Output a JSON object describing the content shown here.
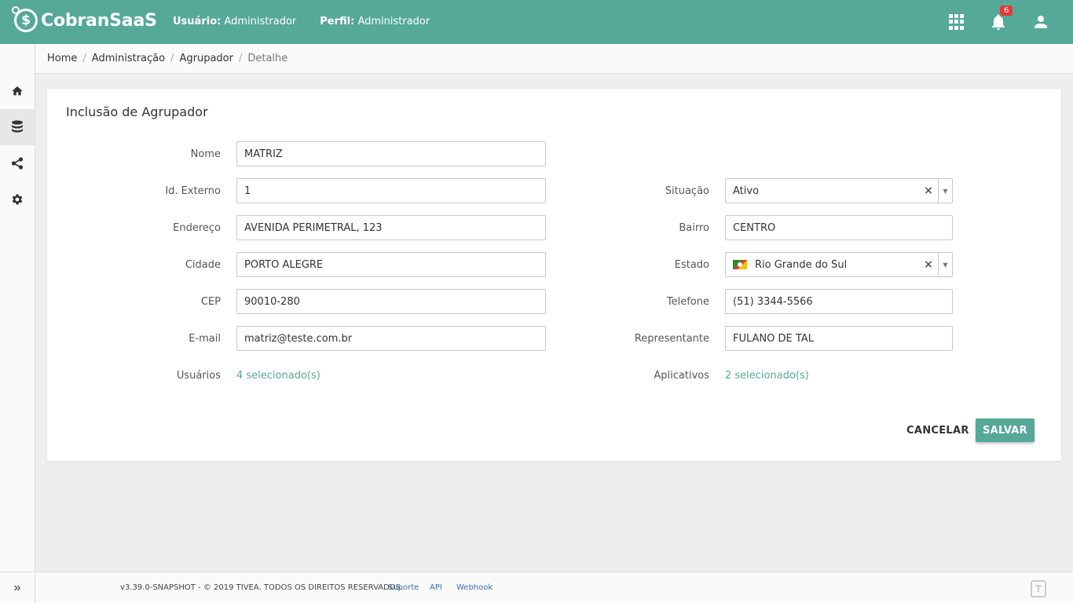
{
  "header": {
    "brand": "CobranSaaS",
    "user_label": "Usuário:",
    "user_value": "Administrador",
    "profile_label": "Perfil:",
    "profile_value": "Administrador",
    "notification_count": "6",
    "accent_color": "#56a899"
  },
  "sidebar": {
    "items": [
      {
        "icon": "home-icon"
      },
      {
        "icon": "database-icon",
        "active": true
      },
      {
        "icon": "share-icon"
      },
      {
        "icon": "gear-icon"
      }
    ],
    "expand_label": "»"
  },
  "breadcrumb": {
    "items": [
      "Home",
      "Administração",
      "Agrupador",
      "Detalhe"
    ],
    "separator": "/"
  },
  "form": {
    "title": "Inclusão de Agrupador",
    "nome": {
      "label": "Nome",
      "value": "MATRIZ"
    },
    "id_externo": {
      "label": "Id. Externo",
      "value": "1"
    },
    "endereco": {
      "label": "Endereço",
      "value": "AVENIDA PERIMETRAL, 123"
    },
    "cidade": {
      "label": "Cidade",
      "value": "PORTO ALEGRE"
    },
    "cep": {
      "label": "CEP",
      "value": "90010-280"
    },
    "email": {
      "label": "E-mail",
      "value": "matriz@teste.com.br"
    },
    "usuarios": {
      "label": "Usuários",
      "value": "4 selecionado(s)"
    },
    "situacao": {
      "label": "Situação",
      "value": "Ativo"
    },
    "bairro": {
      "label": "Bairro",
      "value": "CENTRO"
    },
    "estado": {
      "label": "Estado",
      "value": "Rio Grande do Sul"
    },
    "telefone": {
      "label": "Telefone",
      "value": "(51) 3344-5566"
    },
    "representante": {
      "label": "Representante",
      "value": "FULANO DE TAL"
    },
    "aplicativos": {
      "label": "Aplicativos",
      "value": "2 selecionado(s)"
    },
    "cancel_label": "CANCELAR",
    "save_label": "SALVAR"
  },
  "footer": {
    "copyright": "v3.39.0-SNAPSHOT - © 2019 TIVEA. TODOS OS DIREITOS RESERVADOS.",
    "links": [
      "Suporte",
      "API",
      "Webhook"
    ]
  }
}
